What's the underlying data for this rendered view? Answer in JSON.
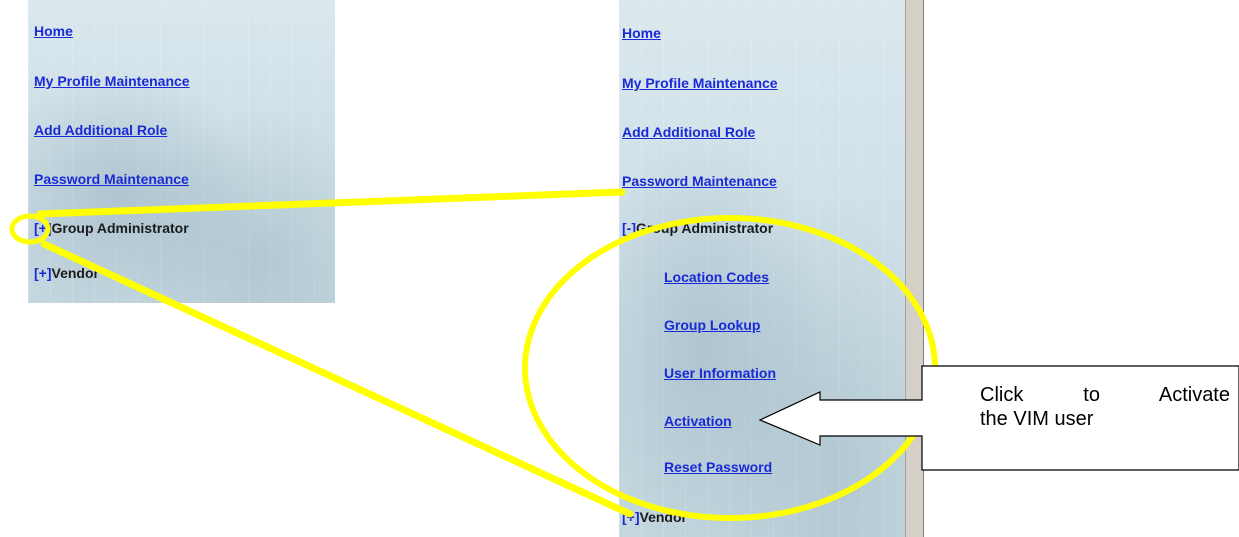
{
  "left_menu": {
    "items": [
      {
        "label": "Home"
      },
      {
        "label": "My Profile Maintenance"
      },
      {
        "label": "Add Additional Role"
      },
      {
        "label": "Password Maintenance"
      }
    ],
    "group_admin": {
      "toggle": "[+]",
      "label": "Group Administrator"
    },
    "vendor": {
      "toggle": "[+]",
      "label": "Vendor"
    }
  },
  "right_menu": {
    "items": [
      {
        "label": "Home"
      },
      {
        "label": "My Profile Maintenance"
      },
      {
        "label": "Add Additional Role"
      },
      {
        "label": "Password Maintenance"
      }
    ],
    "group_admin": {
      "toggle": "[-]",
      "label": "Group Administrator",
      "children": [
        {
          "label": "Location Codes"
        },
        {
          "label": "Group Lookup"
        },
        {
          "label": "User Information"
        },
        {
          "label": "Activation"
        },
        {
          "label": "Reset Password"
        }
      ]
    },
    "vendor": {
      "toggle": "[+]",
      "label": "Vendor"
    }
  },
  "callout": {
    "line1": "Click to Activate",
    "line2": "the VIM user"
  },
  "colors": {
    "link": "#1a2ad6",
    "highlight": "#ffff00",
    "panel": "#cfe0e7"
  }
}
